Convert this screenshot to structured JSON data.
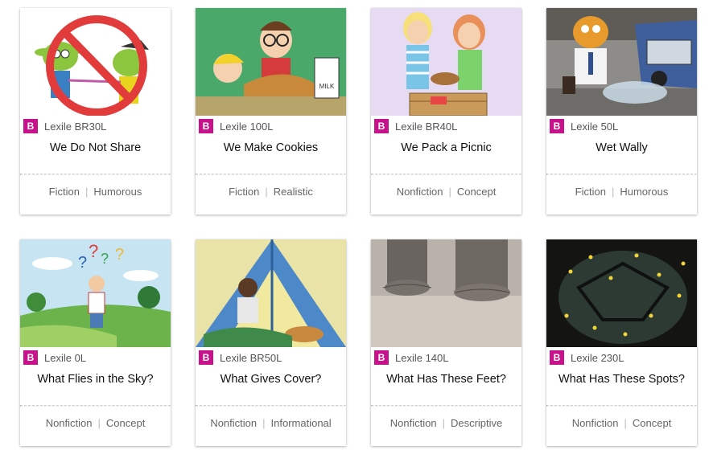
{
  "colors": {
    "badge": "#c8128c",
    "tag_text": "#666666"
  },
  "books": [
    {
      "level": "B",
      "lexile": "Lexile BR30L",
      "title": "We Do Not Share",
      "tags": [
        "Fiction",
        "Humorous"
      ]
    },
    {
      "level": "B",
      "lexile": "Lexile 100L",
      "title": "We Make Cookies",
      "tags": [
        "Fiction",
        "Realistic"
      ]
    },
    {
      "level": "B",
      "lexile": "Lexile BR40L",
      "title": "We Pack a Picnic",
      "tags": [
        "Nonfiction",
        "Concept"
      ]
    },
    {
      "level": "B",
      "lexile": "Lexile 50L",
      "title": "Wet Wally",
      "tags": [
        "Fiction",
        "Humorous"
      ]
    },
    {
      "level": "B",
      "lexile": "Lexile 0L",
      "title": "What Flies in the Sky?",
      "tags": [
        "Nonfiction",
        "Concept"
      ]
    },
    {
      "level": "B",
      "lexile": "Lexile BR50L",
      "title": "What Gives Cover?",
      "tags": [
        "Nonfiction",
        "Informational"
      ]
    },
    {
      "level": "B",
      "lexile": "Lexile 140L",
      "title": "What Has These Feet?",
      "tags": [
        "Nonfiction",
        "Descriptive"
      ]
    },
    {
      "level": "B",
      "lexile": "Lexile 230L",
      "title": "What Has These Spots?",
      "tags": [
        "Nonfiction",
        "Concept"
      ]
    }
  ]
}
